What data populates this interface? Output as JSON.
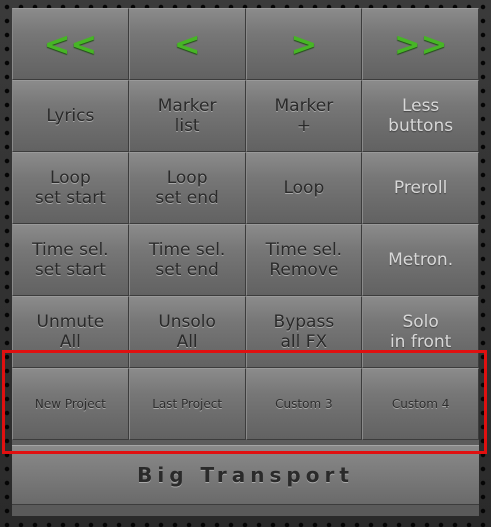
{
  "nav": {
    "rewind_start": "<<",
    "previous": "<",
    "next": ">",
    "forward_end": ">>"
  },
  "row1": [
    "Lyrics",
    "Marker\nlist",
    "Marker\n+",
    "Less\nbuttons"
  ],
  "row2": [
    "Loop\nset start",
    "Loop\nset end",
    "Loop",
    "Preroll"
  ],
  "row3": [
    "Time sel.\nset start",
    "Time sel.\nset end",
    "Time sel.\nRemove",
    "Metron."
  ],
  "row4": [
    "Unmute\nAll",
    "Unsolo\nAll",
    "Bypass\nall FX",
    "Solo\nin front"
  ],
  "row5": [
    "New Project",
    "Last Project",
    "Custom 3",
    "Custom 4"
  ],
  "footer": {
    "big_transport": "Big Transport"
  },
  "colors": {
    "accent_green": "#47b526",
    "highlight_red": "#e01010"
  }
}
